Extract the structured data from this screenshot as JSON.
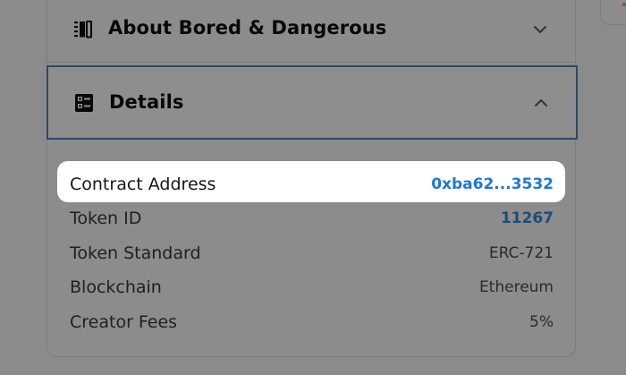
{
  "sections": {
    "about": {
      "title": "About Bored & Dangerous",
      "icon": "text-block-icon",
      "expanded": false
    },
    "details": {
      "title": "Details",
      "icon": "list-details-icon",
      "expanded": true
    }
  },
  "details_rows": [
    {
      "label": "Contract Address",
      "value": "0xba62...3532"
    },
    {
      "label": "Token ID",
      "value": "11267"
    },
    {
      "label": "Token Standard",
      "value": "ERC-721"
    },
    {
      "label": "Blockchain",
      "value": "Ethereum"
    },
    {
      "label": "Creator Fees",
      "value": "5%"
    }
  ],
  "colors": {
    "overlay": "#8b8b8b",
    "link": "#2177d4",
    "focus_border": "#304766",
    "highlight": "#ffffff"
  }
}
